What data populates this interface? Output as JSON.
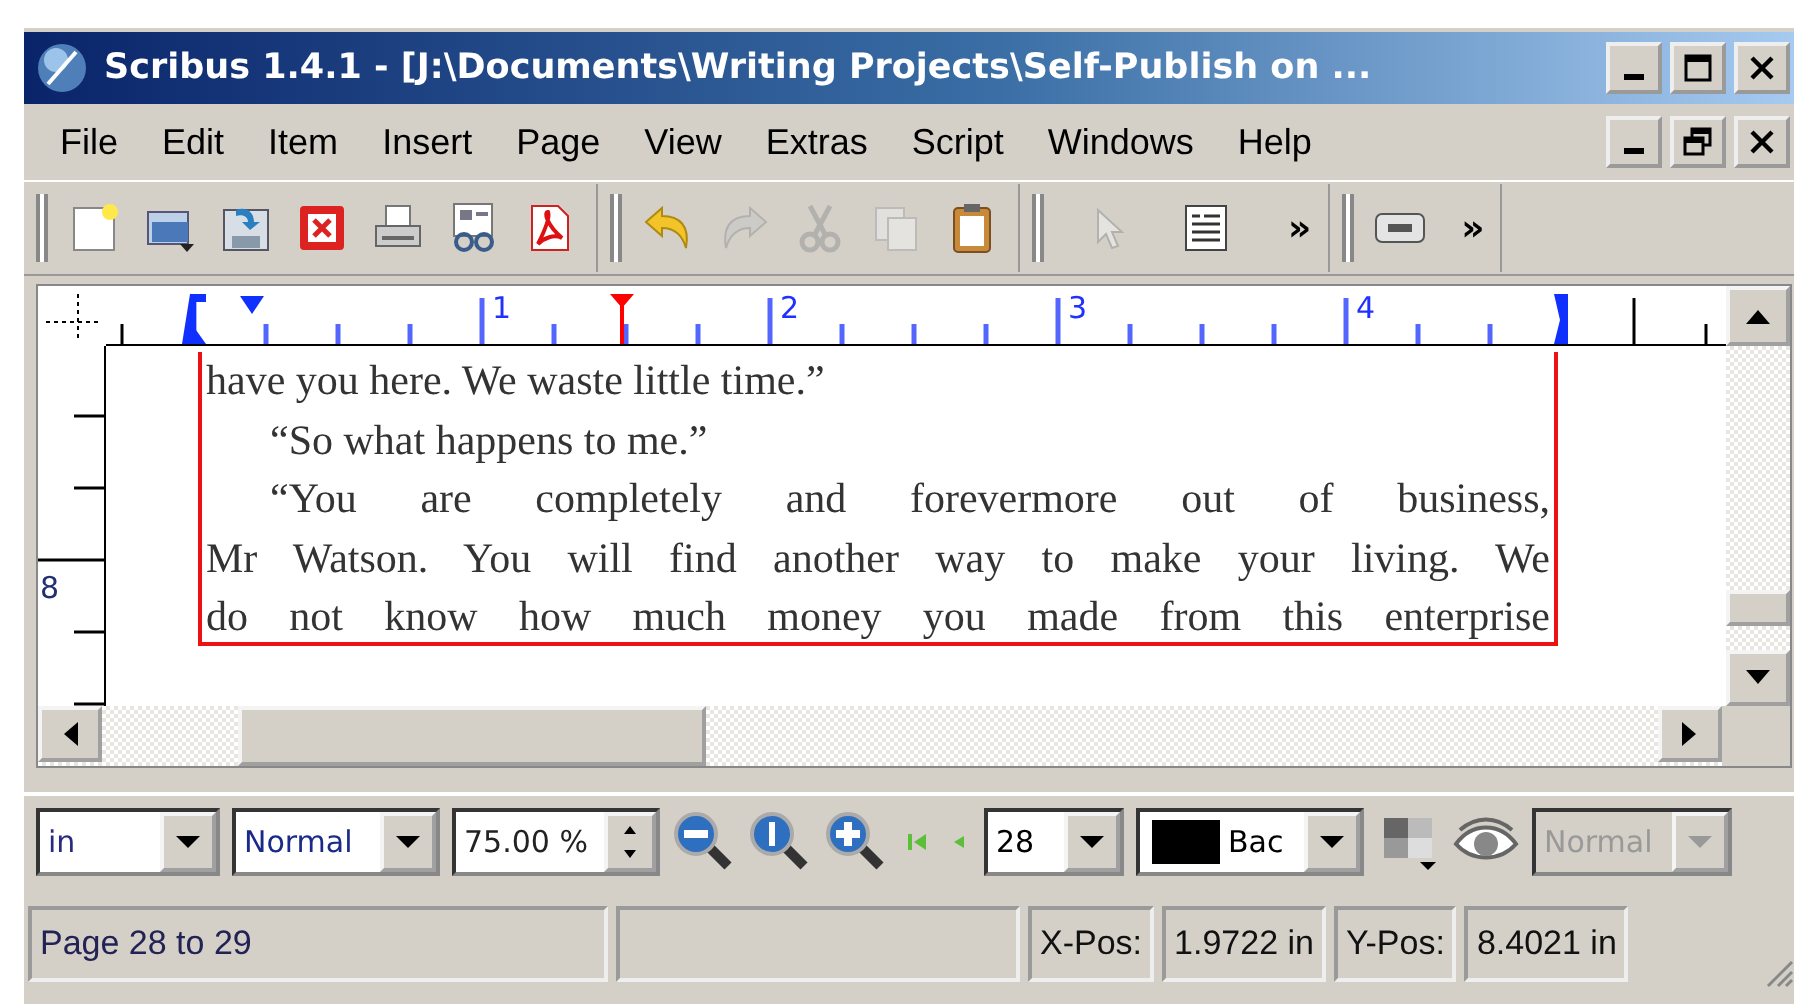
{
  "window": {
    "title": "Scribus 1.4.1 - [J:\\Documents\\Writing Projects\\Self-Publish on ...",
    "controls": [
      {
        "kind": "minimize"
      },
      {
        "kind": "maximize"
      },
      {
        "kind": "close"
      }
    ]
  },
  "menu_bar": {
    "items": [
      "File",
      "Edit",
      "Item",
      "Insert",
      "Page",
      "View",
      "Extras",
      "Script",
      "Windows",
      "Help"
    ],
    "controls": [
      {
        "kind": "minimize"
      },
      {
        "kind": "restore"
      },
      {
        "kind": "close"
      }
    ]
  },
  "toolbar": {
    "groups": [
      {
        "tools": [
          {
            "kind": "new",
            "disabled": false
          },
          {
            "kind": "open",
            "disabled": false
          },
          {
            "kind": "save",
            "disabled": false
          },
          {
            "kind": "close",
            "disabled": false
          },
          {
            "kind": "print",
            "disabled": false
          },
          {
            "kind": "preflight",
            "disabled": false
          },
          {
            "kind": "pdf",
            "disabled": false
          }
        ]
      },
      {
        "tools": [
          {
            "kind": "undo",
            "disabled": false
          },
          {
            "kind": "redo",
            "disabled": true
          },
          {
            "kind": "cut",
            "disabled": true
          },
          {
            "kind": "copy",
            "disabled": true
          },
          {
            "kind": "paste",
            "disabled": false
          }
        ]
      },
      {
        "tools": [
          {
            "kind": "select",
            "disabled": true
          },
          {
            "kind": "textframe",
            "disabled": false
          }
        ],
        "overflow": "»"
      },
      {
        "tools": [
          {
            "kind": "ok",
            "disabled": false
          }
        ],
        "overflow": "»"
      }
    ]
  },
  "ruler": {
    "labels": [
      "1",
      "2",
      "3",
      "4"
    ]
  },
  "vertical_ruler": {
    "labels": [
      "8"
    ]
  },
  "text_frame": {
    "lines": [
      {
        "text": "have you here. We waste little time.”",
        "indent": false,
        "justified": false
      },
      {
        "text": "“So what happens to me.”",
        "indent": true,
        "justified": false
      },
      {
        "text": "“You are completely and forevermore out of business,",
        "indent": true,
        "justified": true
      },
      {
        "text": "Mr Watson. You will find another way to make your living. We",
        "indent": false,
        "justified": true
      },
      {
        "text": "do not know how much money you made from this enterprise",
        "indent": false,
        "justified": true
      }
    ]
  },
  "bottom_toolbar": {
    "unit": "in",
    "quality": "Normal",
    "zoom": "75.00 %",
    "page": "28",
    "layer": "Bac",
    "blend_mode": {
      "value": "Normal",
      "disabled": true
    }
  },
  "status_bar": {
    "page": "Page 28 to 29",
    "x_label": "X-Pos:",
    "x_value": "1.9722 in",
    "y_label": "Y-Pos:",
    "y_value": "8.4021 in"
  }
}
